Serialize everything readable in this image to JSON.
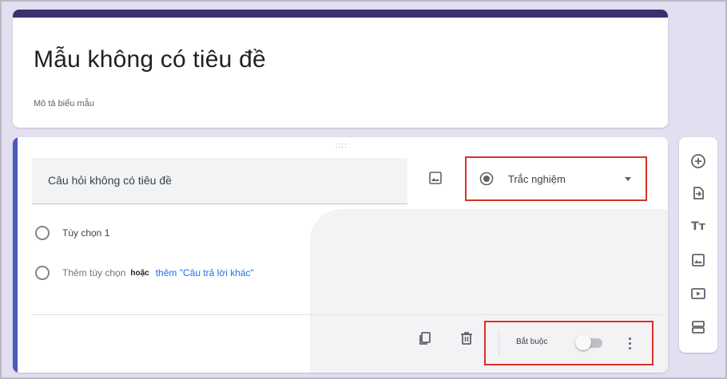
{
  "form": {
    "title": "Mẫu không có tiêu đề",
    "description": "Mô tả biểu mẫu"
  },
  "question": {
    "drag_handle": "∷∷",
    "title": "Câu hỏi không có tiêu đề",
    "type_label": "Trắc nghiệm",
    "options": [
      {
        "label": "Tùy chọn 1"
      }
    ],
    "add_option": "Thêm tùy chọn",
    "or_text": "hoặc",
    "add_other": "thêm \"Câu trả lời khác\"",
    "required_label": "Bắt buộc",
    "required": false
  },
  "toolbar": {
    "items": [
      "add-question-icon",
      "import-questions-icon",
      "add-title-icon",
      "add-image-icon",
      "add-video-icon",
      "add-section-icon"
    ],
    "title_glyph": "Tт"
  },
  "colors": {
    "accent": "#3a3170",
    "question_bar": "#4a5bbd",
    "highlight": "#d93025",
    "link": "#1a73e8"
  }
}
